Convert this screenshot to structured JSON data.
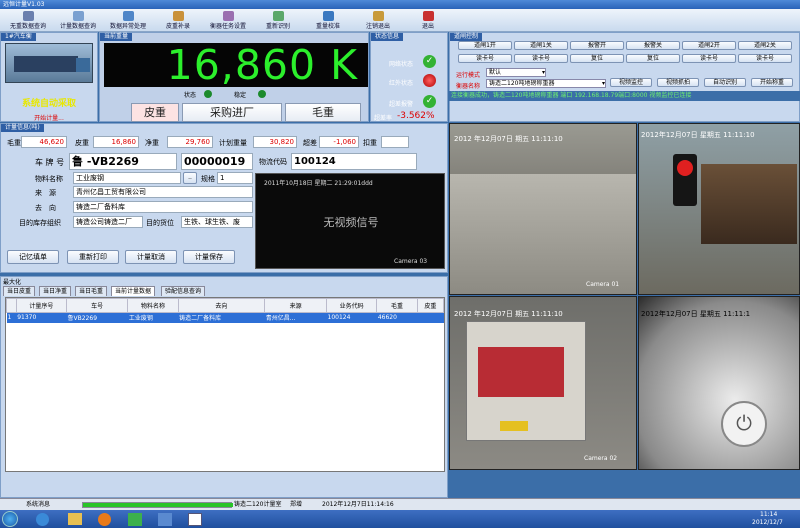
{
  "window": {
    "title": "远恒计量V1.03"
  },
  "toolbar": [
    {
      "label": "无重数据查询",
      "color": "#6a7fae"
    },
    {
      "label": "计量数据查询",
      "color": "#7aa0d0"
    },
    {
      "label": "数据异常处理",
      "color": "#4f86c8"
    },
    {
      "label": "皮重补录",
      "color": "#c9913a"
    },
    {
      "label": "衡器任务设置",
      "color": "#9a6fb0"
    },
    {
      "label": "重新识别",
      "color": "#5ba86a"
    },
    {
      "label": "重量校准",
      "color": "#3a78c0"
    },
    {
      "label": "注销退出",
      "color": "#c89a3a"
    },
    {
      "label": "退出",
      "color": "#c83030"
    }
  ],
  "truck": {
    "title": "1#汽车衡",
    "banner": "系统自动采取",
    "status": "开始计量..."
  },
  "weight": {
    "title": "当前重量",
    "value": "16,860  K",
    "state_label": "状态",
    "stable_label": "稳定",
    "btn_tare": "皮重",
    "btn_purchase": "采购进厂",
    "btn_gross": "毛重"
  },
  "status": {
    "title": "状态信息",
    "network": "网络状态",
    "infrared": "红外状态",
    "overweight": "超差报警",
    "diff_label": "超差率",
    "diff_value": "-3.562%"
  },
  "control": {
    "title": "道闸控制",
    "row1": [
      "道闸1开",
      "道闸1关",
      "报警开",
      "报警关",
      "道闸2开",
      "道闸2关"
    ],
    "row2": [
      "读卡号",
      "读卡号",
      "复位",
      "复位",
      "读卡号",
      "读卡号"
    ],
    "mode_label": "运行模式",
    "mode_value": "默认",
    "scale_label": "衡器名称",
    "scale_value": "铸造二120吨地磅称重器",
    "row3": [
      "视频监控",
      "视频抓拍",
      "自动识别",
      "开始称重"
    ],
    "banner": "连接衡器成功，铸造二120吨地磅称重器 端口 192.168.18.79端口:8000 视频监控已连接"
  },
  "info": {
    "title": "计量信息(吨)",
    "gross_label": "毛重",
    "gross": "46,620",
    "tare_label": "皮重",
    "tare": "16,860",
    "net_label": "净重",
    "net": "29,760",
    "plan_label": "计划重量",
    "plan": "30,820",
    "diff_label": "超差",
    "diff": "-1,060",
    "diff2_label": "扣重",
    "diff2": "",
    "plate_label": "车 牌 号",
    "plate_prefix": "鲁",
    "plate": "-VB2269",
    "seq": "00000019",
    "material_code_label": "物流代码",
    "material_code": "100124",
    "material_label": "物料名称",
    "material": "工业废钢",
    "spec_label": "规格",
    "spec": "1",
    "source_label": "来　源",
    "source": "青州亿昌工贸有限公司",
    "dest_label": "去　向",
    "dest": "铸造二厂备料库",
    "org_label": "目的库存组织",
    "org": "铸造公司铸造二厂",
    "post_label": "目的货位",
    "post": "生铁、球生铁、废",
    "btn_card": "记忆填单",
    "btn_reprint": "重新打印",
    "btn_cancel": "计量取消",
    "btn_save": "计量保存"
  },
  "video": {
    "timestamp": "2011年10月18日 星期二 21:29:01ddd",
    "nosignal": "无视频信号",
    "camera": "Camera 03"
  },
  "cams": [
    {
      "ts": "2012 年12月07日  期五 11:11:10",
      "label": "Camera 01"
    },
    {
      "ts": "2012年12月07日  星期五  11:11:10",
      "label": ""
    },
    {
      "ts": "2012 年12月07日  期五  11:11:10",
      "label": "Camera 02"
    },
    {
      "ts": "2012年12月07日  星期五  11:11:1",
      "label": ""
    }
  ],
  "grid": {
    "title": "最大化",
    "tabs": [
      "当日皮重",
      "当日净重",
      "当日毛重",
      "当前计量数据",
      "验配信息查询"
    ],
    "headers": [
      "",
      "计量序号",
      "车号",
      "物料名称",
      "去向",
      "来源",
      "业务代码",
      "毛重",
      "皮重"
    ],
    "rows": [
      [
        "1",
        "91370",
        "鲁VB2269",
        "工业废钢",
        "铸造二厂备料库",
        "青州亿昌...",
        "100124",
        "46620",
        ""
      ]
    ]
  },
  "statusbar": {
    "label": "系统消息",
    "scale": "铸造二120计量室",
    "user": "郑增",
    "time": "2012年12月7日11:14:16"
  },
  "taskbar": {
    "time": "11:14",
    "date": "2012/12/7"
  }
}
